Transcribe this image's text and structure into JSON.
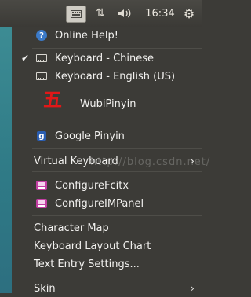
{
  "panel": {
    "clock": "16:34",
    "icons": [
      "keyboard-icon",
      "network-arrows-icon",
      "volume-icon",
      "gear-icon"
    ]
  },
  "menu": {
    "items": [
      {
        "id": "online-help",
        "label": "Online Help!",
        "icon": "help-icon"
      },
      {
        "id": "keyboard-chinese",
        "label": "Keyboard - Chinese",
        "icon": "keyboard-icon",
        "checked": true
      },
      {
        "id": "keyboard-english",
        "label": "Keyboard - English (US)",
        "icon": "keyboard-icon"
      },
      {
        "id": "wubipinyin",
        "label": "WubiPinyin",
        "icon": "wubi-icon",
        "glyph": "五"
      },
      {
        "id": "google-pinyin",
        "label": "Google Pinyin",
        "icon": "google-icon",
        "glyph": "g"
      },
      {
        "id": "virtual-keyboard",
        "label": "Virtual Keyboard",
        "submenu": true
      },
      {
        "id": "configure-fcitx",
        "label": "ConfigureFcitx",
        "icon": "config-icon"
      },
      {
        "id": "configure-impanel",
        "label": "ConfigureIMPanel",
        "icon": "config-icon"
      },
      {
        "id": "character-map",
        "label": "Character Map"
      },
      {
        "id": "keyboard-layout-chart",
        "label": "Keyboard Layout Chart"
      },
      {
        "id": "text-entry-settings",
        "label": "Text Entry Settings..."
      },
      {
        "id": "skin",
        "label": "Skin",
        "submenu": true
      }
    ],
    "check_mark": "✔",
    "submenu_arrow": "›"
  },
  "watermark": "http://blog.csdn.net/",
  "colors": {
    "menu_bg": "#3c3b37",
    "menu_text": "#f2f1ef",
    "wubi_red": "#e11818",
    "help_blue": "#3b7ac8"
  }
}
